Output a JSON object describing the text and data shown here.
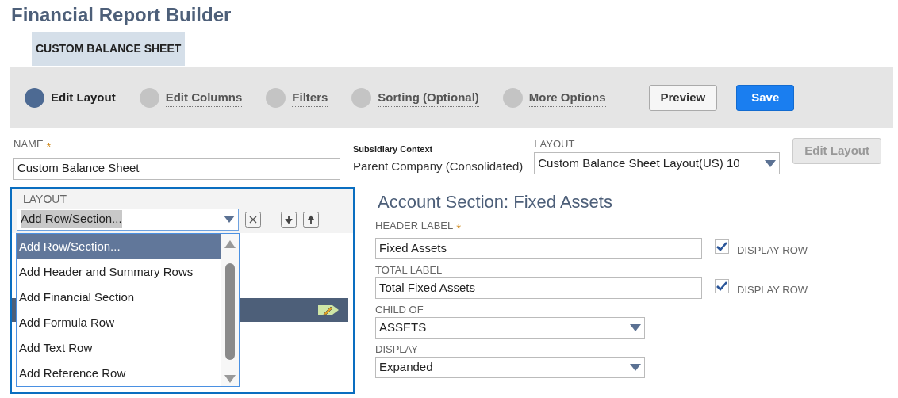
{
  "title": "Financial Report Builder",
  "report_tab": {
    "label": "CUSTOM BALANCE SHEET",
    "selected": true
  },
  "steps": [
    {
      "label": "Edit Layout",
      "selected": true
    },
    {
      "label": "Edit Columns",
      "selected": false
    },
    {
      "label": "Filters",
      "selected": false
    },
    {
      "label": "Sorting (Optional)",
      "selected": false
    },
    {
      "label": "More Options",
      "selected": false
    }
  ],
  "actions": [
    {
      "label": "Preview",
      "kind": "secondary"
    },
    {
      "label": "Save",
      "kind": "primary"
    }
  ],
  "name_field": {
    "label": "NAME",
    "required_mark": "*",
    "value": "Custom Balance Sheet"
  },
  "subsidiary": {
    "label": "Subsidiary Context",
    "value": "Parent Company (Consolidated)"
  },
  "layout_select": {
    "label": "LAYOUT",
    "value": "Custom Balance Sheet Layout(US) 10"
  },
  "edit_layout_button": {
    "label": "Edit Layout",
    "disabled": true
  },
  "layout_panel": {
    "label": "LAYOUT",
    "add_select": {
      "value": "Add Row/Section...",
      "options": [
        {
          "label": "Add Row/Section...",
          "selected": true
        },
        {
          "label": "Add Header and Summary Rows",
          "selected": false
        },
        {
          "label": "Add Financial Section",
          "selected": false
        },
        {
          "label": "Add Formula Row",
          "selected": false
        },
        {
          "label": "Add Text Row",
          "selected": false
        },
        {
          "label": "Add Reference Row",
          "selected": false
        }
      ]
    }
  },
  "section": {
    "title": "Account Section: Fixed Assets",
    "fields": [
      {
        "kind": "text",
        "label": "HEADER LABEL",
        "required_mark": "*",
        "value": "Fixed Assets",
        "display_row": {
          "label": "DISPLAY ROW",
          "checked": true
        }
      },
      {
        "kind": "text",
        "label": "TOTAL LABEL",
        "value": "Total Fixed Assets",
        "display_row": {
          "label": "DISPLAY ROW",
          "checked": true
        }
      },
      {
        "kind": "select",
        "label": "CHILD OF",
        "value": "ASSETS"
      },
      {
        "kind": "select",
        "label": "DISPLAY",
        "value": "Expanded"
      }
    ]
  }
}
